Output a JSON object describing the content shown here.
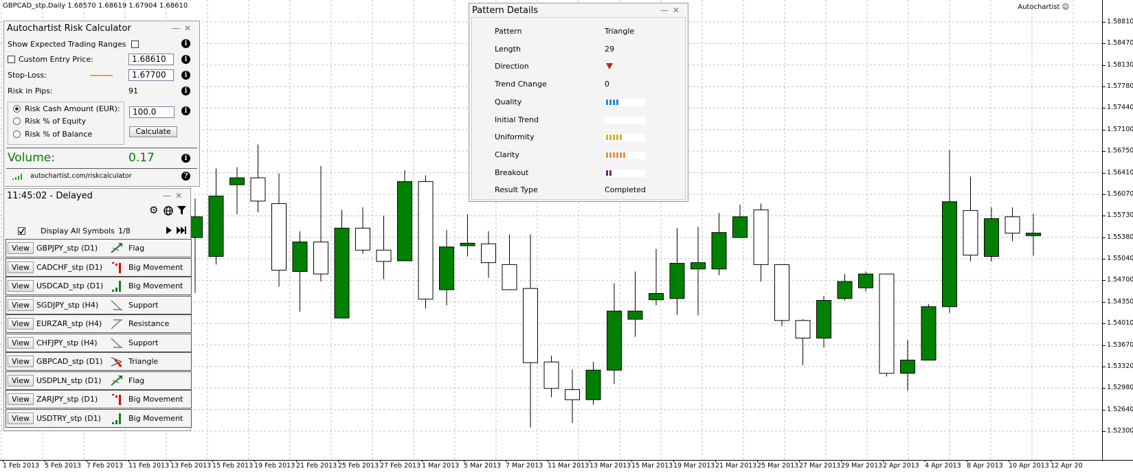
{
  "chart": {
    "symbol_line": "GBPCAD_stp,Daily  1.68570 1.68619 1.67904 1.68610",
    "brand": "Autochartist",
    "y_labels": [
      "1.58810",
      "1.58470",
      "1.58130",
      "1.57780",
      "1.57440",
      "1.57100",
      "1.56750",
      "1.56410",
      "1.56070",
      "1.55730",
      "1.55380",
      "1.55040",
      "1.54700",
      "1.54350",
      "1.54010",
      "1.53670",
      "1.53320",
      "1.52980",
      "1.52640",
      "1.52300"
    ],
    "x_labels": [
      "1 Feb 2013",
      "5 Feb 2013",
      "7 Feb 2013",
      "11 Feb 2013",
      "13 Feb 2013",
      "15 Feb 2013",
      "19 Feb 2013",
      "21 Feb 2013",
      "25 Feb 2013",
      "27 Feb 2013",
      "1 Mar 2013",
      "5 Mar 2013",
      "7 Mar 2013",
      "11 Mar 2013",
      "13 Mar 2013",
      "15 Mar 2013",
      "19 Mar 2013",
      "21 Mar 2013",
      "25 Mar 2013",
      "27 Mar 2013",
      "29 Mar 2013",
      "2 Apr 2013",
      "4 Apr 2013",
      "8 Apr 2013",
      "10 Apr 2013",
      "12 Apr 20"
    ],
    "colors": {
      "bull": "#008000",
      "bear": "#ffffff",
      "outline": "#000000",
      "grid": "#c0c0c0"
    },
    "candles": [
      {
        "o": 1.5538,
        "h": 1.56,
        "l": 1.545,
        "c": 1.5571
      },
      {
        "o": 1.5508,
        "h": 1.5648,
        "l": 1.5495,
        "c": 1.5604
      },
      {
        "o": 1.5622,
        "h": 1.565,
        "l": 1.5575,
        "c": 1.5633
      },
      {
        "o": 1.5633,
        "h": 1.5686,
        "l": 1.5578,
        "c": 1.5596
      },
      {
        "o": 1.5592,
        "h": 1.564,
        "l": 1.546,
        "c": 1.5486
      },
      {
        "o": 1.5484,
        "h": 1.5548,
        "l": 1.542,
        "c": 1.5531
      },
      {
        "o": 1.5531,
        "h": 1.5652,
        "l": 1.5468,
        "c": 1.548
      },
      {
        "o": 1.541,
        "h": 1.5582,
        "l": 1.541,
        "c": 1.5553
      },
      {
        "o": 1.5553,
        "h": 1.5586,
        "l": 1.5512,
        "c": 1.5518
      },
      {
        "o": 1.5518,
        "h": 1.5573,
        "l": 1.5472,
        "c": 1.55
      },
      {
        "o": 1.5501,
        "h": 1.5645,
        "l": 1.5501,
        "c": 1.5627
      },
      {
        "o": 1.5627,
        "h": 1.5637,
        "l": 1.5425,
        "c": 1.544
      },
      {
        "o": 1.5455,
        "h": 1.555,
        "l": 1.543,
        "c": 1.5523
      },
      {
        "o": 1.5525,
        "h": 1.5575,
        "l": 1.5508,
        "c": 1.5529
      },
      {
        "o": 1.5528,
        "h": 1.5548,
        "l": 1.5474,
        "c": 1.5498
      },
      {
        "o": 1.5495,
        "h": 1.5543,
        "l": 1.5454,
        "c": 1.5455
      },
      {
        "o": 1.5457,
        "h": 1.5543,
        "l": 1.5236,
        "c": 1.5339
      },
      {
        "o": 1.534,
        "h": 1.535,
        "l": 1.5284,
        "c": 1.5298
      },
      {
        "o": 1.5296,
        "h": 1.5328,
        "l": 1.5243,
        "c": 1.528
      },
      {
        "o": 1.528,
        "h": 1.534,
        "l": 1.5272,
        "c": 1.5327
      },
      {
        "o": 1.5327,
        "h": 1.5465,
        "l": 1.5305,
        "c": 1.5421
      },
      {
        "o": 1.5408,
        "h": 1.5484,
        "l": 1.538,
        "c": 1.5421
      },
      {
        "o": 1.5439,
        "h": 1.552,
        "l": 1.543,
        "c": 1.5449
      },
      {
        "o": 1.5441,
        "h": 1.5553,
        "l": 1.5415,
        "c": 1.5497
      },
      {
        "o": 1.5488,
        "h": 1.5555,
        "l": 1.5414,
        "c": 1.5498
      },
      {
        "o": 1.5488,
        "h": 1.5577,
        "l": 1.5478,
        "c": 1.5546
      },
      {
        "o": 1.5538,
        "h": 1.559,
        "l": 1.5538,
        "c": 1.5571
      },
      {
        "o": 1.5582,
        "h": 1.5592,
        "l": 1.5468,
        "c": 1.5495
      },
      {
        "o": 1.5495,
        "h": 1.5495,
        "l": 1.5397,
        "c": 1.5406
      },
      {
        "o": 1.5406,
        "h": 1.5408,
        "l": 1.5335,
        "c": 1.5378
      },
      {
        "o": 1.5378,
        "h": 1.5445,
        "l": 1.5363,
        "c": 1.5438
      },
      {
        "o": 1.5441,
        "h": 1.548,
        "l": 1.5438,
        "c": 1.5468
      },
      {
        "o": 1.5458,
        "h": 1.5484,
        "l": 1.5452,
        "c": 1.548
      },
      {
        "o": 1.548,
        "h": 1.548,
        "l": 1.5317,
        "c": 1.5322
      },
      {
        "o": 1.5322,
        "h": 1.5375,
        "l": 1.5294,
        "c": 1.5343
      },
      {
        "o": 1.5343,
        "h": 1.5432,
        "l": 1.5343,
        "c": 1.5428
      },
      {
        "o": 1.5428,
        "h": 1.5677,
        "l": 1.5418,
        "c": 1.5595
      },
      {
        "o": 1.5581,
        "h": 1.5635,
        "l": 1.55,
        "c": 1.551
      },
      {
        "o": 1.5508,
        "h": 1.5586,
        "l": 1.55,
        "c": 1.5568
      },
      {
        "o": 1.5571,
        "h": 1.5586,
        "l": 1.5532,
        "c": 1.5545
      },
      {
        "o": 1.5541,
        "h": 1.5576,
        "l": 1.5509,
        "c": 1.5545
      }
    ]
  },
  "risk_calc": {
    "title": "Autochartist Risk Calculator",
    "show_ranges_label": "Show Expected Trading Ranges",
    "custom_entry_label": "Custom Entry Price:",
    "custom_entry_value": "1.68610",
    "stop_loss_label": "Stop-Loss:",
    "stop_loss_value": "1.67700",
    "risk_pips_label": "Risk in Pips:",
    "risk_pips_value": "91",
    "radio_cash": "Risk Cash Amount (EUR):",
    "radio_equity": "Risk % of Equity",
    "radio_balance": "Risk % of Balance",
    "amount_value": "100.0",
    "calculate_label": "Calculate",
    "volume_label": "Volume:",
    "volume_value": "0.17",
    "link_text": "autochartist.com/riskcalculator",
    "volume_color": "#008000",
    "stop_line_color": "#e6a817"
  },
  "symbols_panel": {
    "time_text": "11:45:02 - Delayed",
    "display_all_label": "Display All Symbols",
    "page_counter": "1/8",
    "view_label": "View",
    "rows": [
      {
        "symbol": "GBPJPY_stp (D1)",
        "pattern": "Flag",
        "icon": "flag-icon"
      },
      {
        "symbol": "CADCHF_stp (D1)",
        "pattern": "Big Movement",
        "icon": "big-movement-down-icon"
      },
      {
        "symbol": "USDCAD_stp (D1)",
        "pattern": "Big Movement",
        "icon": "big-movement-up-icon"
      },
      {
        "symbol": "SGDJPY_stp (H4)",
        "pattern": "Support",
        "icon": "support-icon"
      },
      {
        "symbol": "EURZAR_stp (H4)",
        "pattern": "Resistance",
        "icon": "resistance-icon"
      },
      {
        "symbol": "CHFJPY_stp (H4)",
        "pattern": "Support",
        "icon": "support-icon"
      },
      {
        "symbol": "GBPCAD_stp (D1)",
        "pattern": "Triangle",
        "icon": "triangle-icon"
      },
      {
        "symbol": "USDPLN_stp (D1)",
        "pattern": "Flag",
        "icon": "flag-icon"
      },
      {
        "symbol": "ZARJPY_stp (D1)",
        "pattern": "Big Movement",
        "icon": "big-movement-down-icon"
      },
      {
        "symbol": "USDTRY_stp (D1)",
        "pattern": "Big Movement",
        "icon": "big-movement-up-icon"
      }
    ]
  },
  "pattern_details": {
    "title": "Pattern Details",
    "rows": [
      {
        "key": "Pattern",
        "value": "Triangle"
      },
      {
        "key": "Length",
        "value": "29"
      },
      {
        "key": "Direction",
        "value": ""
      },
      {
        "key": "Trend Change",
        "value": "0"
      },
      {
        "key": "Quality",
        "value": ""
      },
      {
        "key": "Initial Trend",
        "value": ""
      },
      {
        "key": "Uniformity",
        "value": ""
      },
      {
        "key": "Clarity",
        "value": ""
      },
      {
        "key": "Breakout",
        "value": ""
      },
      {
        "key": "Result Type",
        "value": "Completed"
      }
    ],
    "bars": {
      "quality": {
        "segments": 4,
        "color": "#1e88e5"
      },
      "initial_trend": {
        "segments": 0,
        "color": "#cccccc"
      },
      "uniformity": {
        "segments": 5,
        "color": "#d4b030"
      },
      "clarity": {
        "segments": 6,
        "color": "#f08c50"
      },
      "breakout": {
        "segments": 2,
        "color": "#7b1f7b"
      }
    },
    "direction_color": "#c0202a"
  }
}
